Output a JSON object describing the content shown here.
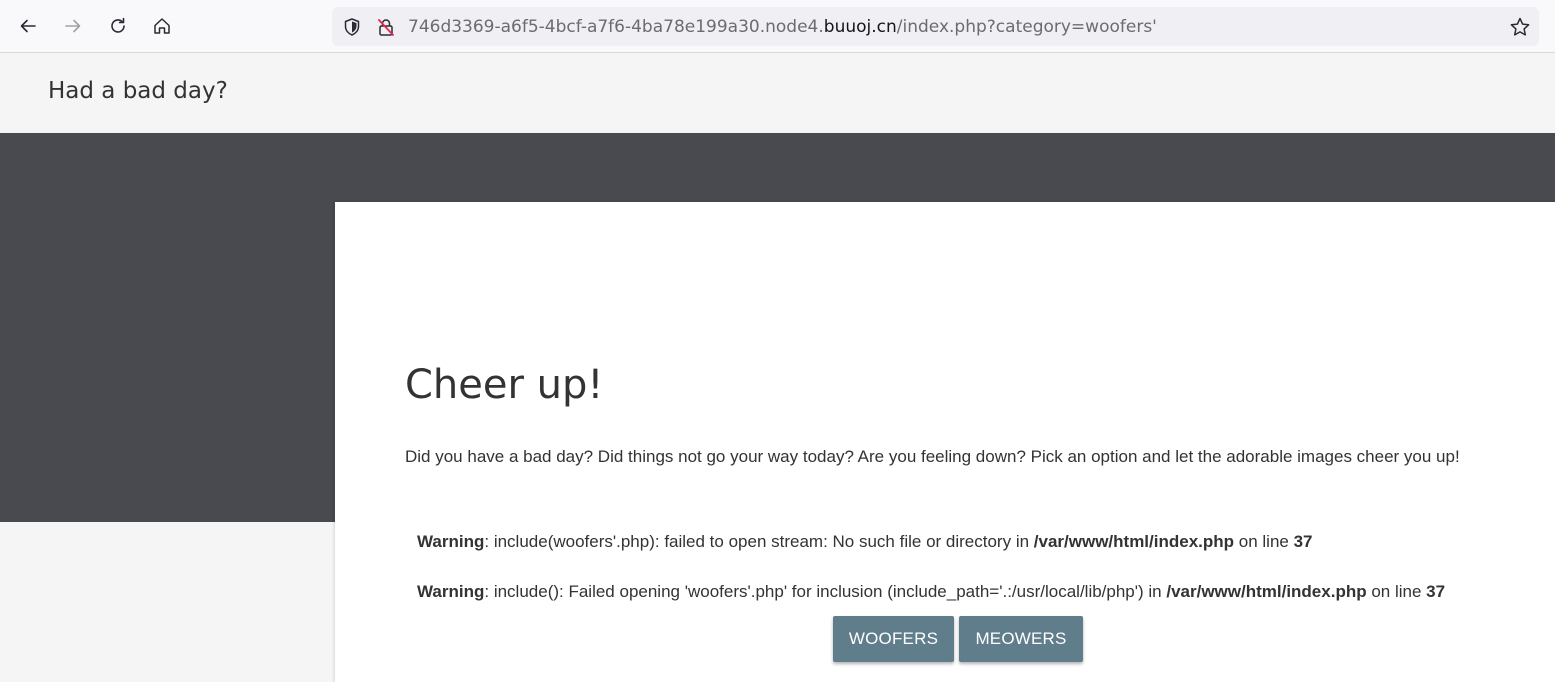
{
  "browser": {
    "url_prefix": "746d3369-a6f5-4bcf-a7f6-4ba78e199a30.node4.",
    "url_domain": "buuoj.cn",
    "url_path": "/index.php?category=woofers'"
  },
  "header": {
    "title": "Had a bad day?"
  },
  "card": {
    "title": "Cheer up!",
    "description": "Did you have a bad day? Did things not go your way today? Are you feeling down? Pick an option and let the adorable images cheer you up!"
  },
  "warnings": [
    {
      "label": "Warning",
      "message": ": include(woofers'.php): failed to open stream: No such file or directory in ",
      "file": "/var/www/html/index.php",
      "line_text": " on line ",
      "line": "37"
    },
    {
      "label": "Warning",
      "message": ": include(): Failed opening 'woofers'.php' for inclusion (include_path='.:/usr/local/lib/php') in ",
      "file": "/var/www/html/index.php",
      "line_text": " on line ",
      "line": "37"
    }
  ],
  "buttons": {
    "woofers": "Woofers",
    "meowers": "Meowers"
  },
  "colors": {
    "hero_bg": "#484a4f",
    "button_bg": "#607d8b"
  }
}
